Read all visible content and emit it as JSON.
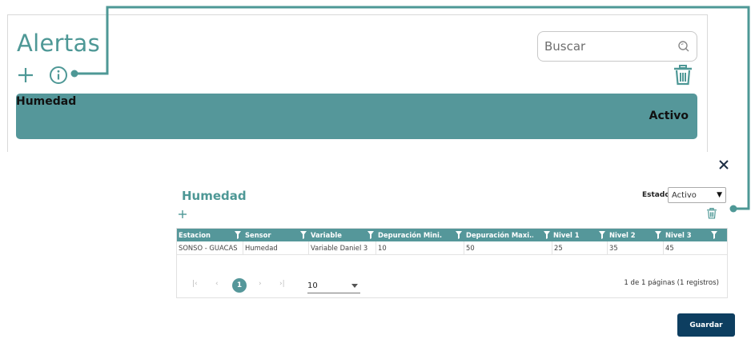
{
  "page": {
    "title": "Alertas",
    "search": {
      "placeholder": "Buscar",
      "value": ""
    }
  },
  "icons": {
    "add": "plus-icon",
    "info": "info-icon",
    "delete": "trash-icon",
    "search": "search-icon",
    "close": "close-icon",
    "filter": "filter-icon"
  },
  "colors": {
    "accent": "#55979a",
    "title": "#4e9896",
    "primary_button": "#0d3e60",
    "connector": "#4e9896"
  },
  "alerts": [
    {
      "name": "Humedad",
      "status": "Activo"
    }
  ],
  "modal": {
    "title": "Humedad",
    "estado_label": "Estado:",
    "estado_value": "Activo",
    "estado_options": [
      "Activo"
    ],
    "table": {
      "columns": [
        "Estacion",
        "Sensor",
        "Variable",
        "Depuración Mini...",
        "Depuración Maxi...",
        "Nivel 1",
        "Nivel 2",
        "Nivel 3"
      ],
      "rows": [
        [
          "SONSO - GUACAS",
          "Humedad",
          "Variable Daniel 3",
          "10",
          "50",
          "25",
          "35",
          "45"
        ]
      ]
    },
    "pager": {
      "current_page": "1",
      "page_size": "10",
      "info": "1 de 1 páginas (1 registros)"
    },
    "save_label": "Guardar"
  }
}
